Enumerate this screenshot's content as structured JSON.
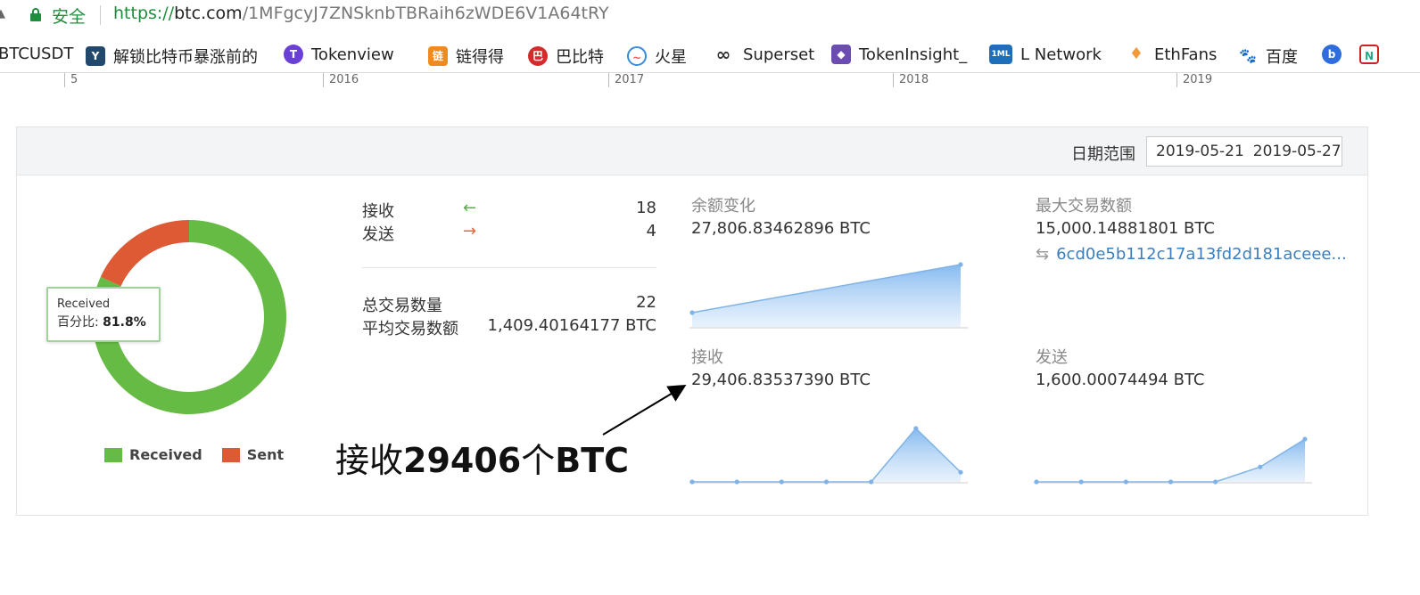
{
  "address_bar": {
    "secure_label": "安全",
    "url_scheme": "https://",
    "url_host": "btc.com",
    "url_path": "/1MFgcyJ7ZNSknbTBRaih6zWDE6V1A64tRY"
  },
  "bookmarks": [
    {
      "label": "BTCUSDT",
      "icon": "none",
      "color": "#ffffff"
    },
    {
      "label": "解锁比特币暴涨前的",
      "icon": "y-logo-icon",
      "color": "#22496b"
    },
    {
      "label": "Tokenview",
      "icon": "t-logo-icon",
      "color": "#6a3fd6"
    },
    {
      "label": "链得得",
      "icon": "chain-logo-icon",
      "color": "#f08a1c"
    },
    {
      "label": "巴比特",
      "icon": "babite-logo-icon",
      "color": "#d52b2b"
    },
    {
      "label": "火星",
      "icon": "mars-logo-icon",
      "color": "#3a8cd6"
    },
    {
      "label": "Superset",
      "icon": "infinity-icon",
      "color": "#333333"
    },
    {
      "label": "TokenInsight_",
      "icon": "tokeninsight-logo-icon",
      "color": "#6b4cb0"
    },
    {
      "label": "L  Network",
      "icon": "1ml-logo-icon",
      "color": "#1c6fb8"
    },
    {
      "label": "EthFans",
      "icon": "ethereum-icon",
      "color": "#f29a3b"
    },
    {
      "label": "百度",
      "icon": "baidu-paw-icon",
      "color": "#2e6ddb"
    },
    {
      "label": "",
      "icon": "b-logo-icon",
      "color": "#2e6ddb"
    },
    {
      "label": "",
      "icon": "n-logo-icon",
      "color": "#c22"
    }
  ],
  "bookmark_icon_text": {
    "y": "Y",
    "t": "T",
    "chain": "链",
    "babite": "巴",
    "tokeninsight": "◆",
    "oneml": "1ML",
    "baidu": "🐾",
    "b": "b",
    "n": "N"
  },
  "timeline": [
    "5",
    "2016",
    "2017",
    "2018",
    "2019"
  ],
  "panel": {
    "date_label": "日期范围",
    "date_start": "2019-05-21",
    "date_end": "2019-05-27"
  },
  "donut": {
    "received_pct": 81.8,
    "tooltip_series": "Received",
    "tooltip_label": "百分比: ",
    "tooltip_value": "81.8%",
    "legend": [
      {
        "name": "Received",
        "color": "#66bb44"
      },
      {
        "name": "Sent",
        "color": "#dd5a35"
      }
    ],
    "colors": {
      "received": "#66bb44",
      "sent": "#dd5a35"
    }
  },
  "stats": {
    "received_label": "接收",
    "received_count": "18",
    "sent_label": "发送",
    "sent_count": "4",
    "total_label": "总交易数量",
    "total_value": "22",
    "avg_label": "平均交易数额",
    "avg_value": "1,409.40164177 BTC",
    "received_arrow_color": "#55b046",
    "sent_arrow_color": "#e06a3a"
  },
  "metrics": {
    "balance_change": {
      "title": "余额变化",
      "value": "27,806.83462896 BTC"
    },
    "max_tx": {
      "title": "最大交易数额",
      "value": "15,000.14881801 BTC",
      "txid": "6cd0e5b112c17a13fd2d181aceee..."
    },
    "received": {
      "title": "接收",
      "value": "29,406.83537390 BTC"
    },
    "sent": {
      "title": "发送",
      "value": "1,600.00074494 BTC"
    }
  },
  "chart_data": [
    {
      "type": "area",
      "title": "余额变化",
      "values": [
        0,
        1
      ],
      "ylim": [
        0,
        1
      ]
    },
    {
      "type": "area",
      "title": "接收",
      "values": [
        0,
        0,
        0,
        0,
        0,
        1,
        0.18
      ],
      "ylim": [
        0,
        1
      ]
    },
    {
      "type": "area",
      "title": "发送",
      "values": [
        0,
        0,
        0,
        0,
        0,
        0.28,
        0.8
      ],
      "ylim": [
        0,
        1
      ]
    }
  ],
  "annotation": {
    "prefix": "接收",
    "bold": "29406",
    "mid": "个",
    "suffix": "BTC"
  }
}
